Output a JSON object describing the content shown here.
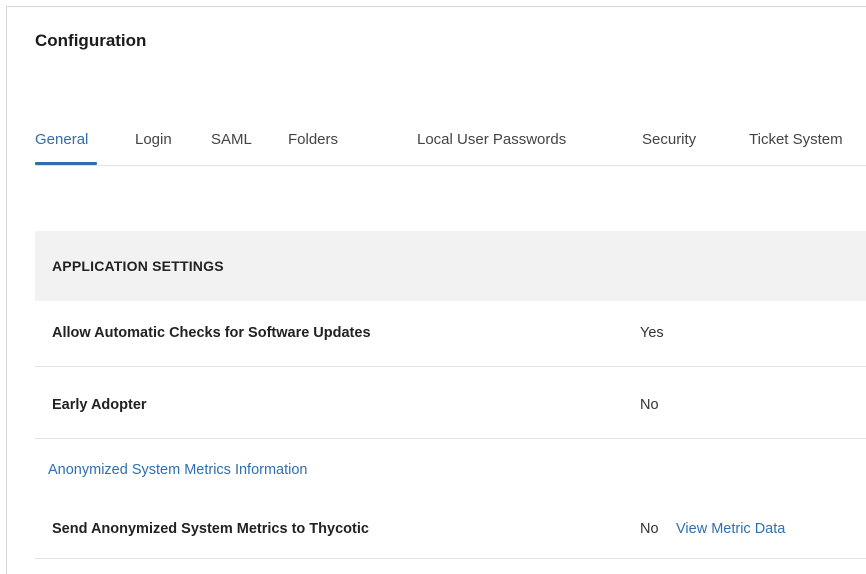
{
  "page": {
    "title": "Configuration"
  },
  "tabs": [
    {
      "label": "General",
      "active": true
    },
    {
      "label": "Login",
      "active": false
    },
    {
      "label": "SAML",
      "active": false
    },
    {
      "label": "Folders",
      "active": false
    },
    {
      "label": "Local User Passwords",
      "active": false
    },
    {
      "label": "Security",
      "active": false
    },
    {
      "label": "Ticket System",
      "active": false
    }
  ],
  "section": {
    "header": "APPLICATION SETTINGS",
    "settings": [
      {
        "label": "Allow Automatic Checks for Software Updates",
        "value": "Yes"
      },
      {
        "label": "Early Adopter",
        "value": "No"
      }
    ],
    "metrics": {
      "heading_link": "Anonymized System Metrics Information",
      "label": "Send Anonymized System Metrics to Thycotic",
      "value": "No",
      "action_link": "View Metric Data"
    }
  },
  "colors": {
    "accent": "#2f6fb0",
    "header_bg": "#f2f2f2",
    "divider": "#e3e3e3"
  }
}
